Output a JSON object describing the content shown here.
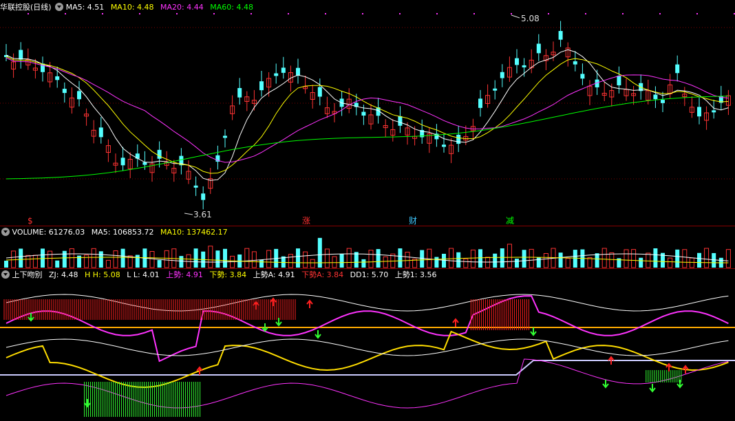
{
  "main_panel": {
    "stock_name": "华联控股",
    "period": "(日线)",
    "indicators": [
      {
        "label": "MA5: 4.51",
        "color": "#ffffff"
      },
      {
        "label": "MA10: 4.48",
        "color": "#ffff00"
      },
      {
        "label": "MA20: 4.44",
        "color": "#ff33ff"
      },
      {
        "label": "MA60: 4.48",
        "color": "#00ff00"
      }
    ],
    "high_label": "5.08",
    "low_label": "3.61",
    "markers": [
      {
        "text": "$",
        "color": "#ff3030"
      },
      {
        "text": "涨",
        "color": "#ff3030"
      },
      {
        "text": "财",
        "color": "#40c8ff"
      },
      {
        "text": "减",
        "color": "#00ff00"
      }
    ],
    "up_color": "#ff3333",
    "down_color": "#54ffff"
  },
  "volume_panel": {
    "indicators": [
      {
        "label": "VOLUME: 61276.03",
        "color": "#ffffff"
      },
      {
        "label": "MA5: 106853.72",
        "color": "#ffffff"
      },
      {
        "label": "MA10: 137462.17",
        "color": "#ffff00"
      }
    ]
  },
  "oscillator_panel": {
    "indicators": [
      {
        "label": "上下吻别",
        "color": "#ffffff"
      },
      {
        "label": "ZJ: 4.48",
        "color": "#ffffff"
      },
      {
        "label": "H H: 5.08",
        "color": "#ffff00"
      },
      {
        "label": "L L: 4.01",
        "color": "#ffffff"
      },
      {
        "label": "上勢: 4.91",
        "color": "#ff33ff"
      },
      {
        "label": "下勢: 3.84",
        "color": "#ffff00"
      },
      {
        "label": "上勢A: 4.91",
        "color": "#ffffff"
      },
      {
        "label": "下勢A: 3.84",
        "color": "#ff3333"
      },
      {
        "label": "DD1: 5.70",
        "color": "#ffffff"
      },
      {
        "label": "上勢1: 3.56",
        "color": "#ffffff"
      }
    ]
  },
  "icons": [
    "settings-circle-icon",
    "high-arrow-icon",
    "low-arrow-icon",
    "red-up-arrow-icon",
    "green-down-arrow-icon"
  ]
}
